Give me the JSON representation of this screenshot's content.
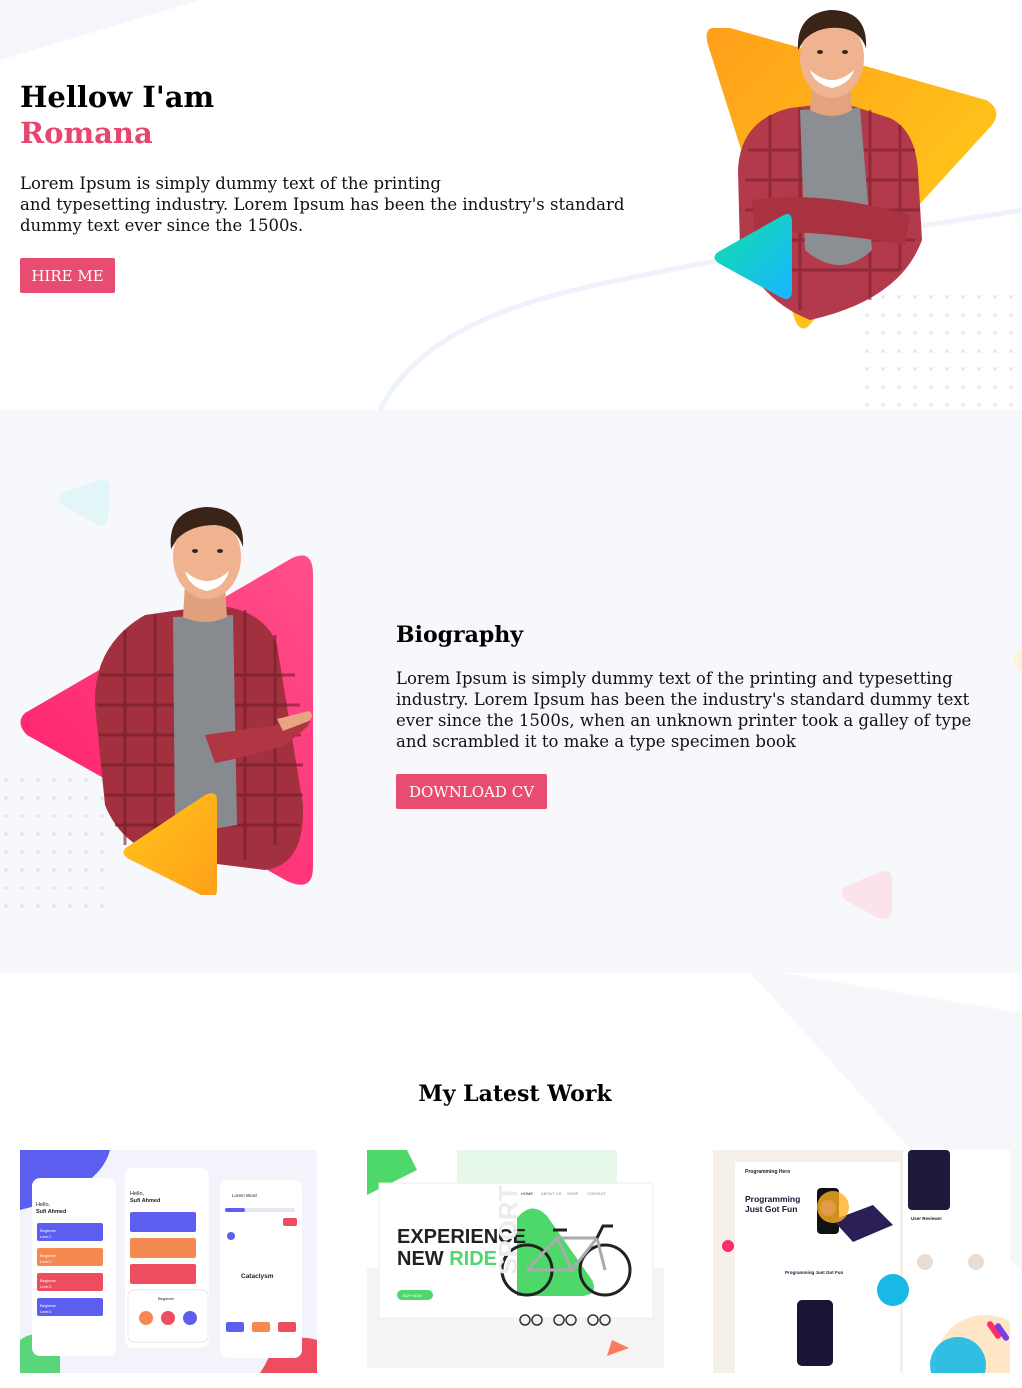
{
  "hero": {
    "greeting": "Hellow I'am",
    "name": "Romana",
    "description": "Lorem Ipsum is simply dummy text of the printing and typesetting industry. Lorem Ipsum has been the industry's standard dummy text ever since the 1500s.",
    "description_line1": "Lorem Ipsum is simply dummy text of the printing",
    "description_line2": "and typesetting industry. Lorem Ipsum has been the industry's standard dummy text ever since the 1500s.",
    "button": "HIRE ME"
  },
  "biography": {
    "title": "Biography",
    "text": "Lorem Ipsum is simply dummy text of the printing and typesetting industry. Lorem Ipsum has been the industry's standard dummy text ever since the 1500s, when an unknown printer took a galley of type and scrambled it to make a type specimen book",
    "button": "DOWNLOAD CV"
  },
  "work": {
    "title": "My Latest Work",
    "cards": [
      {
        "screens": {
          "hello1": "Hello,",
          "user1": "Sufi Ahmed",
          "hello2": "Hello,",
          "user2": "Sufi Ahmed",
          "header3": "Lorem Word",
          "word": "Cataclysm",
          "beginner": "Beginner",
          "level1": "Level 1",
          "level2": "Level 2",
          "level3": "Level 3",
          "level4": "Level 4"
        }
      },
      {
        "headline1": "EXPERIENCE",
        "headline2a": "NEW ",
        "headline2b": "RIDE",
        "watermark": "SPORT",
        "nav": [
          "HOME",
          "ABOUT US",
          "SHOP",
          "CONTACT"
        ],
        "cta": "BUY NOW"
      },
      {
        "brand": "Programming Hero",
        "hero_line1": "Programming",
        "hero_line2": "Just Got Fun",
        "section": "Programming Just Got Fun",
        "reviews": "User Reviews!"
      }
    ]
  },
  "colors": {
    "accent": "#e8456e",
    "button": "#e84c70",
    "bio_bg": "#f7f8fc"
  }
}
